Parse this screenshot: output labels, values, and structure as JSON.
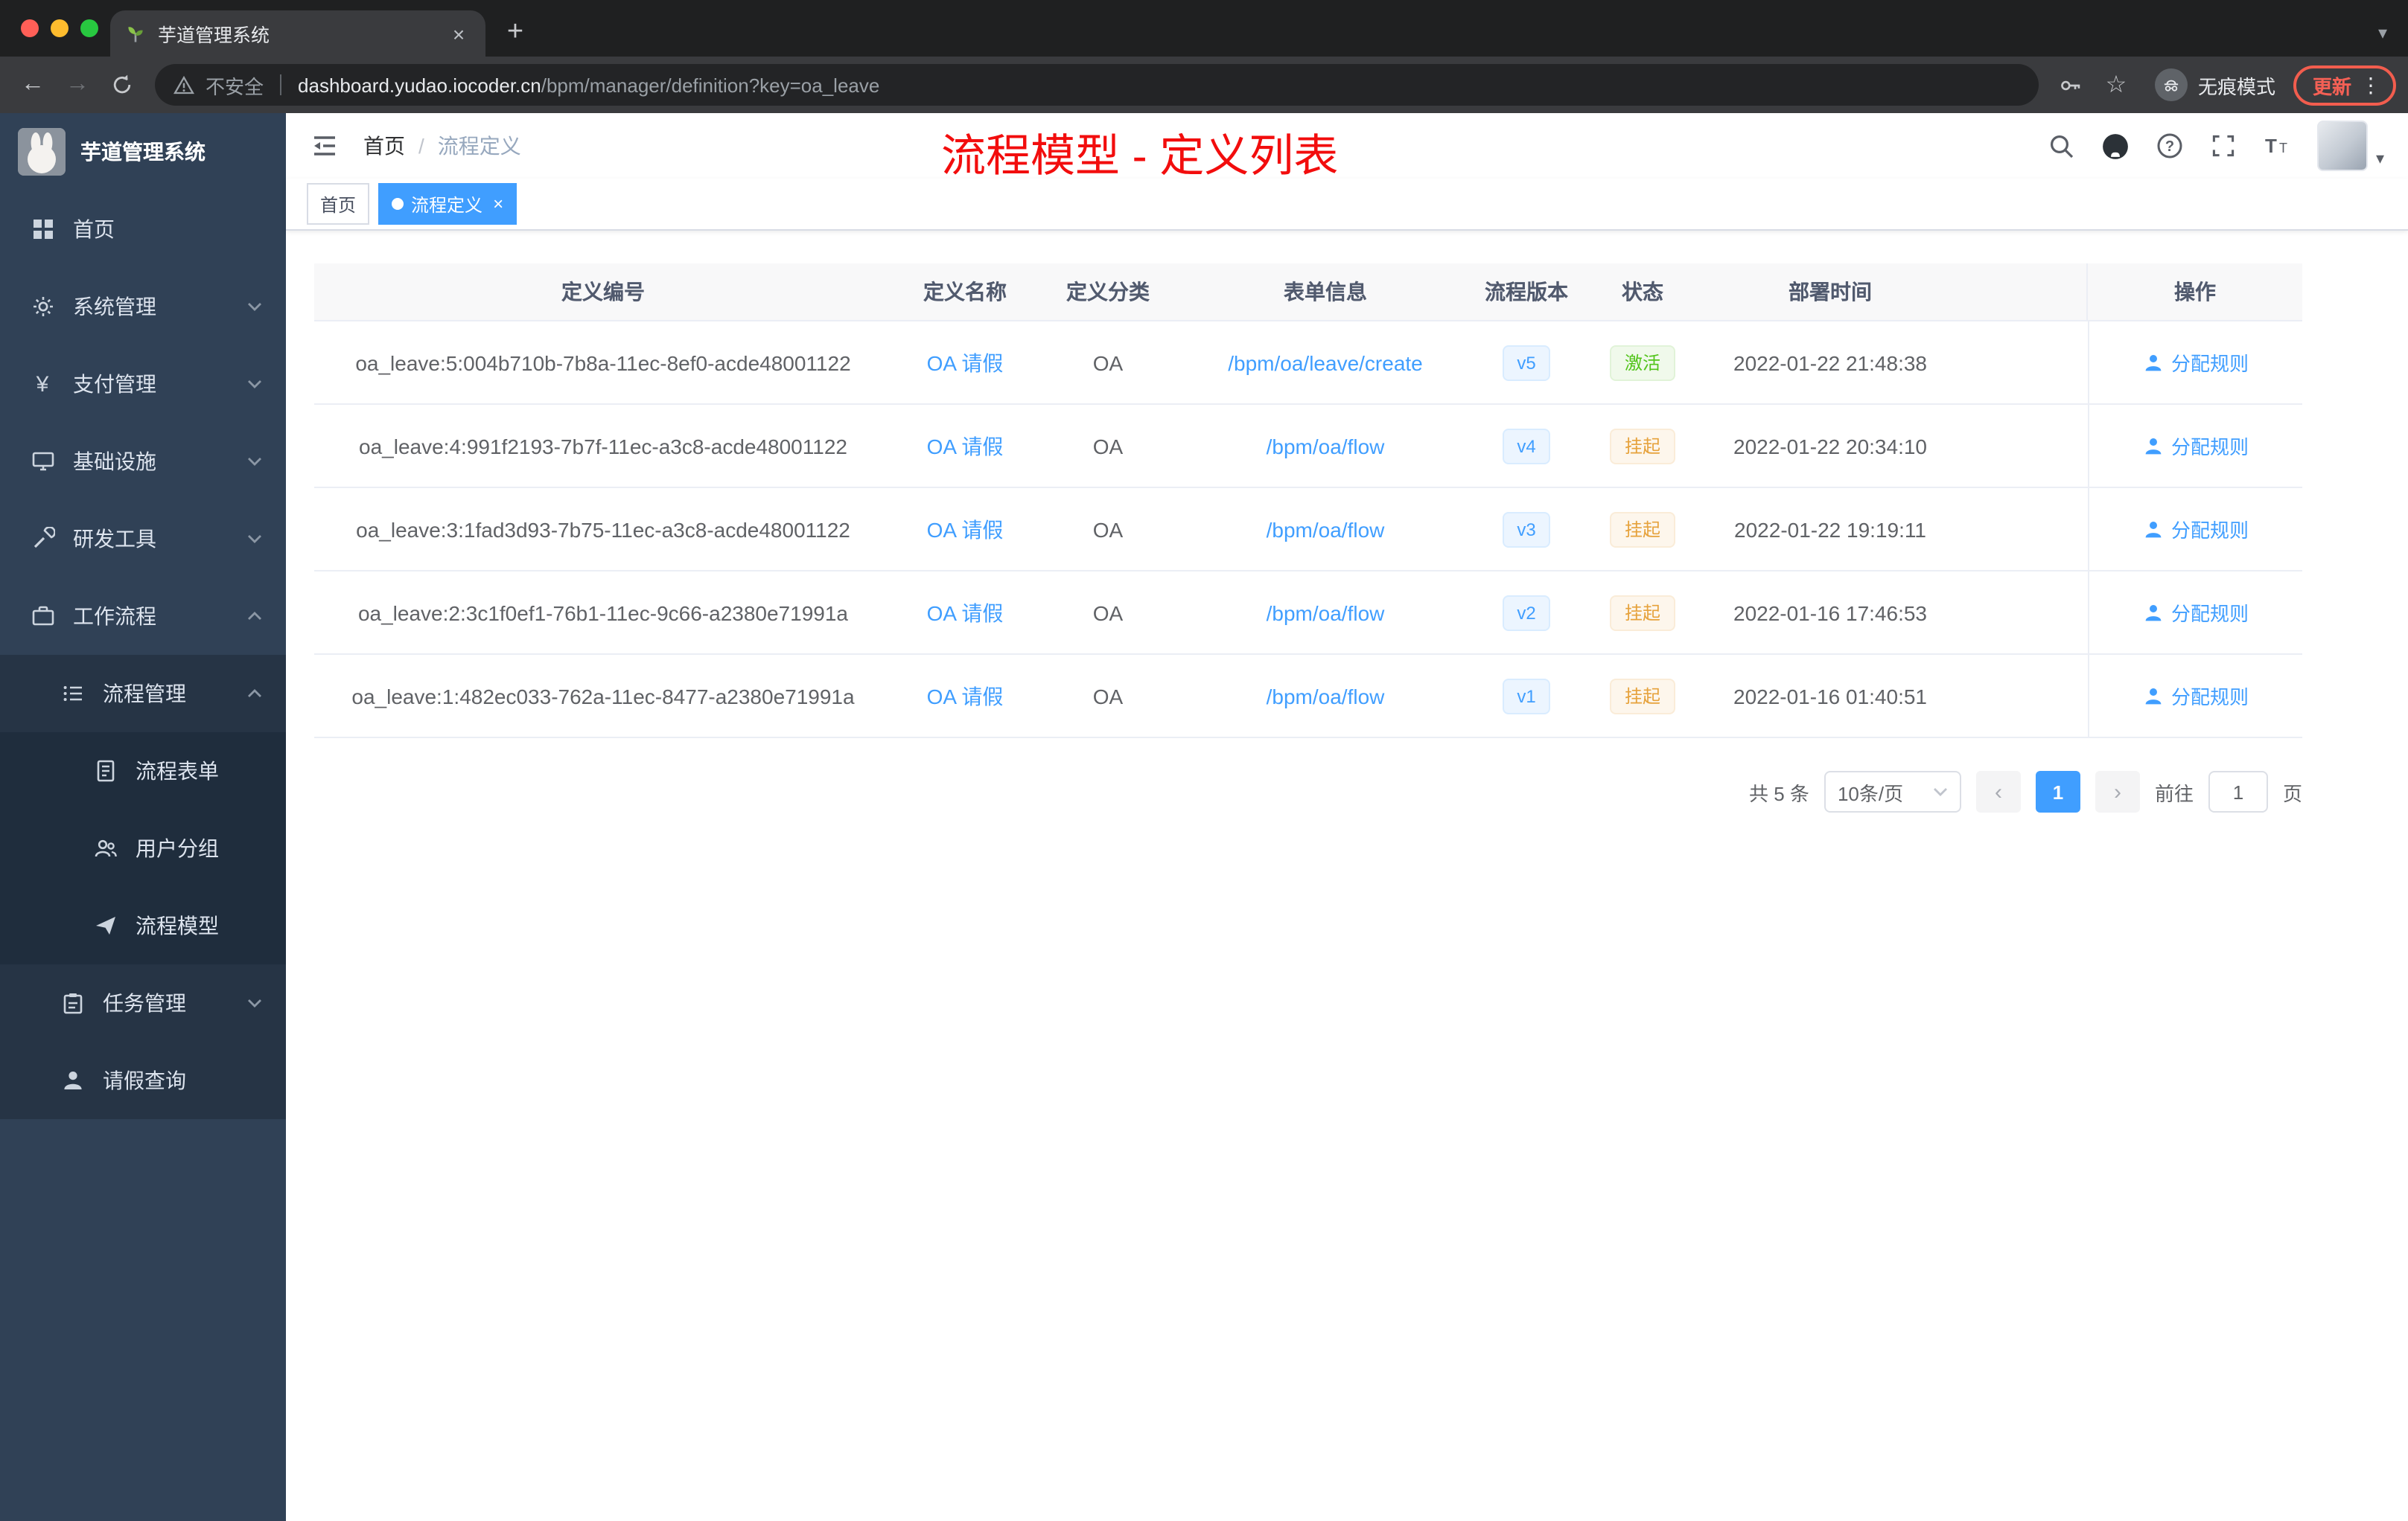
{
  "icons": {
    "back": "←",
    "forward": "→",
    "star": "☆",
    "kebab": "⋮",
    "new_tab": "+",
    "close": "×",
    "caret_down": "▾"
  },
  "browser": {
    "tab_title": "芋道管理系统",
    "security_label": "不安全",
    "url_domain": "dashboard.yudao.iocoder.cn",
    "url_path": "/bpm/manager/definition?key=oa_leave",
    "incognito_label": "无痕模式",
    "update_label": "更新"
  },
  "sidebar": {
    "logo_title": "芋道管理系统",
    "items": [
      {
        "label": "首页"
      },
      {
        "label": "系统管理"
      },
      {
        "label": "支付管理"
      },
      {
        "label": "基础设施"
      },
      {
        "label": "研发工具"
      },
      {
        "label": "工作流程"
      },
      {
        "label": "流程管理"
      },
      {
        "label": "流程表单"
      },
      {
        "label": "用户分组"
      },
      {
        "label": "流程模型"
      },
      {
        "label": "任务管理"
      },
      {
        "label": "请假查询"
      }
    ]
  },
  "header": {
    "breadcrumb_home": "首页",
    "breadcrumb_sep": "/",
    "breadcrumb_current": "流程定义",
    "annotation": "流程模型 - 定义列表"
  },
  "tags": {
    "home": "首页",
    "active": "流程定义"
  },
  "table": {
    "columns": [
      "定义编号",
      "定义名称",
      "定义分类",
      "表单信息",
      "流程版本",
      "状态",
      "部署时间",
      "操作"
    ],
    "rows": [
      {
        "id": "oa_leave:5:004b710b-7b8a-11ec-8ef0-acde48001122",
        "name": "OA 请假",
        "category": "OA",
        "form": "/bpm/oa/leave/create",
        "version": "v5",
        "status": "激活",
        "status_type": "success",
        "deploy_time": "2022-01-22 21:48:38",
        "action": "分配规则"
      },
      {
        "id": "oa_leave:4:991f2193-7b7f-11ec-a3c8-acde48001122",
        "name": "OA 请假",
        "category": "OA",
        "form": "/bpm/oa/flow",
        "version": "v4",
        "status": "挂起",
        "status_type": "warning",
        "deploy_time": "2022-01-22 20:34:10",
        "action": "分配规则"
      },
      {
        "id": "oa_leave:3:1fad3d93-7b75-11ec-a3c8-acde48001122",
        "name": "OA 请假",
        "category": "OA",
        "form": "/bpm/oa/flow",
        "version": "v3",
        "status": "挂起",
        "status_type": "warning",
        "deploy_time": "2022-01-22 19:19:11",
        "action": "分配规则"
      },
      {
        "id": "oa_leave:2:3c1f0ef1-76b1-11ec-9c66-a2380e71991a",
        "name": "OA 请假",
        "category": "OA",
        "form": "/bpm/oa/flow",
        "version": "v2",
        "status": "挂起",
        "status_type": "warning",
        "deploy_time": "2022-01-16 17:46:53",
        "action": "分配规则"
      },
      {
        "id": "oa_leave:1:482ec033-762a-11ec-8477-a2380e71991a",
        "name": "OA 请假",
        "category": "OA",
        "form": "/bpm/oa/flow",
        "version": "v1",
        "status": "挂起",
        "status_type": "warning",
        "deploy_time": "2022-01-16 01:40:51",
        "action": "分配规则"
      }
    ]
  },
  "pagination": {
    "total": "共 5 条",
    "page_size": "10条/页",
    "prev": "‹",
    "page": "1",
    "next": "›",
    "goto": "前往",
    "goto_value": "1",
    "unit": "页"
  }
}
